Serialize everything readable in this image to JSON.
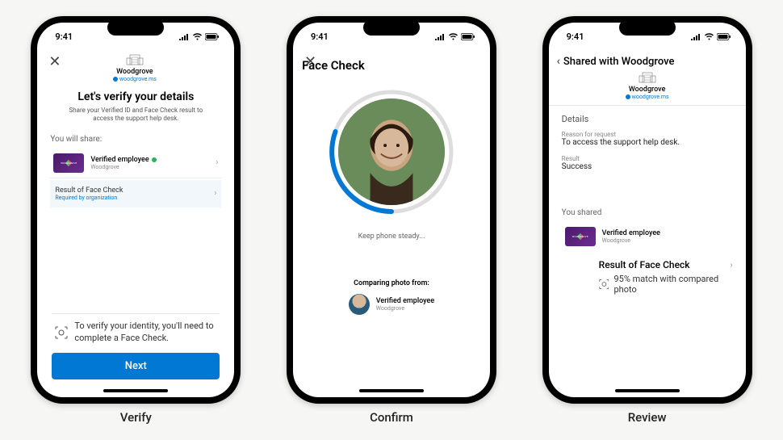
{
  "status": {
    "time": "9:41"
  },
  "brand": {
    "name": "Woodgrove",
    "url": "woodgrove.ms"
  },
  "captions": {
    "verify": "Verify",
    "confirm": "Confirm",
    "review": "Review"
  },
  "screen1": {
    "title": "Let's verify your details",
    "subtitle": "Share your Verified ID and Face Check result to access the support help desk.",
    "share_label": "You will share:",
    "item1_title": "Verified employee",
    "item1_sub": "Woodgrove",
    "item2_title": "Result of Face Check",
    "item2_sub": "Required by organization",
    "note": "To verify your identity, you'll need to complete a Face Check.",
    "next": "Next"
  },
  "screen2": {
    "title": "Face Check",
    "steady": "Keep phone steady...",
    "compare_label": "Comparing photo from:",
    "comp_title": "Verified employee",
    "comp_sub": "Woodgrove"
  },
  "screen3": {
    "back_title": "Shared with Woodgrove",
    "details": "Details",
    "reason_label": "Reason for request",
    "reason_val": "To access the support help desk.",
    "result_label": "Result",
    "result_val": "Success",
    "shared_label": "You shared",
    "cred_title": "Verified employee",
    "cred_sub": "Woodgrove",
    "fc_result": "Result of Face Check",
    "match": "95% match with compared photo"
  }
}
